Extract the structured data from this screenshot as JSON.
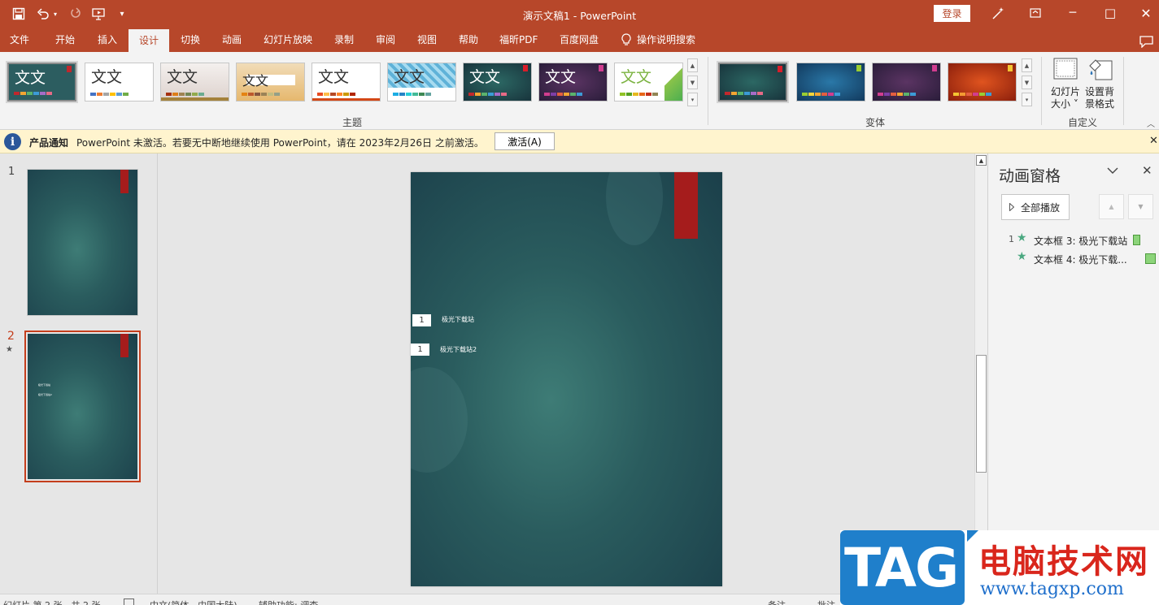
{
  "window": {
    "title": "演示文稿1  -  PowerPoint",
    "login": "登录",
    "buttons": {
      "minimize": "─",
      "maximize": "□",
      "close": "✕"
    }
  },
  "tabs": [
    "文件",
    "开始",
    "插入",
    "设计",
    "切换",
    "动画",
    "幻灯片放映",
    "录制",
    "审阅",
    "视图",
    "帮助",
    "福昕PDF",
    "百度网盘"
  ],
  "active_tab": "设计",
  "tell_me": "操作说明搜索",
  "ribbon": {
    "themes_label": "主题",
    "variants_label": "变体",
    "customize_label": "自定义",
    "theme_text": "文文",
    "slide_size": [
      "幻灯片",
      "大小 ˅"
    ],
    "bg_format": [
      "设置背",
      "景格式"
    ]
  },
  "notice": {
    "title": "产品通知",
    "message": "PowerPoint 未激活。若要无中断地继续使用 PowerPoint，请在 2023年2月26日 之前激活。",
    "button": "激活(A)"
  },
  "slides": [
    {
      "number": "1",
      "mark": ""
    },
    {
      "number": "2",
      "mark": "★"
    }
  ],
  "current_slide": {
    "box1": {
      "badge": "1",
      "text": "极光下载站"
    },
    "box2": {
      "badge": "1",
      "text": "极光下载站2"
    },
    "thumb_text1": "极光下载站",
    "thumb_text2": "极光下载站2"
  },
  "animation_pane": {
    "title": "动画窗格",
    "play_all": "全部播放",
    "items": [
      {
        "order": "1",
        "label": "文本框 3: 极光下载站"
      },
      {
        "order": "",
        "label": "文本框 4: 极光下载..."
      }
    ]
  },
  "statusbar": {
    "slide_info": "幻灯片 第 2 张，共 2 张",
    "language": "中文(简体，中国大陆)",
    "accessibility": "辅助功能: 调查",
    "notes": "备注",
    "comments": "批注"
  },
  "watermark": {
    "tag": "TAG",
    "site_name": "电脑技术网",
    "url": "www.tagxp.com"
  },
  "colors": {
    "brand": "#b7472a",
    "slide_accent": "#a51c1c",
    "notice_bg": "#fff4ce",
    "star": "#4aa880",
    "anim_bar": "#8cd47a"
  }
}
